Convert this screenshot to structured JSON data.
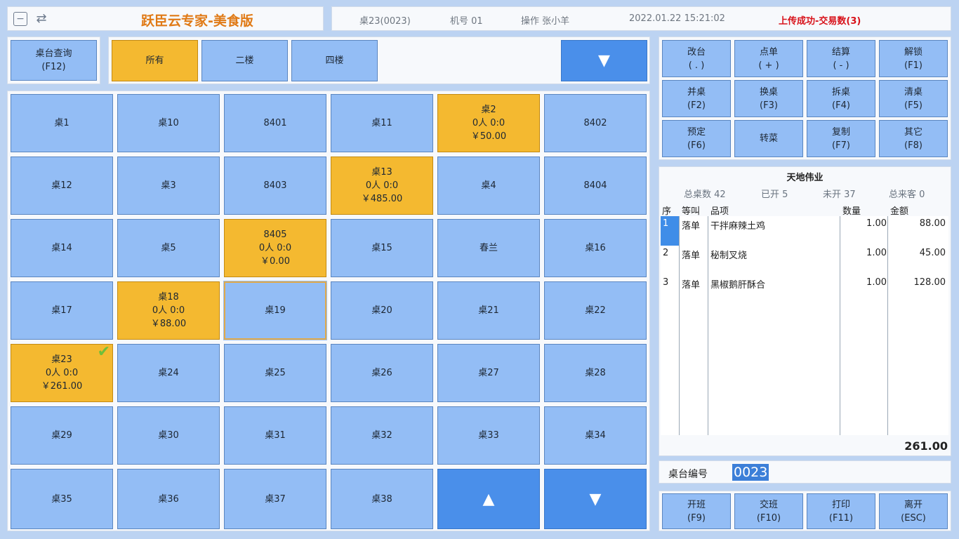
{
  "app": {
    "title": "跃臣云专家-美食版"
  },
  "status_bar": {
    "table": "桌23(0023)",
    "machine": "机号 01",
    "operator": "操作 张小羊",
    "datetime": "2022.01.22 15:21:02",
    "upload": "上传成功-交易数(3)"
  },
  "query_button": {
    "line1": "桌台查询",
    "line2": "(F12)"
  },
  "floors": [
    {
      "label": "所有"
    },
    {
      "label": "二楼"
    },
    {
      "label": "四楼"
    }
  ],
  "floor_scroll_icon": "down-arrow-icon",
  "tables": [
    {
      "name": "桌1"
    },
    {
      "name": "桌10"
    },
    {
      "name": "8401"
    },
    {
      "name": "桌11"
    },
    {
      "name": "桌2",
      "guests": "0人 0:0",
      "amount": "￥50.00",
      "occupied": true
    },
    {
      "name": "8402"
    },
    {
      "name": "桌12"
    },
    {
      "name": "桌3"
    },
    {
      "name": "8403"
    },
    {
      "name": "桌13",
      "guests": "0人 0:0",
      "amount": "￥485.00",
      "occupied": true
    },
    {
      "name": "桌4"
    },
    {
      "name": "8404"
    },
    {
      "name": "桌14"
    },
    {
      "name": "桌5"
    },
    {
      "name": "8405",
      "guests": "0人 0:0",
      "amount": "￥0.00",
      "occupied": true
    },
    {
      "name": "桌15"
    },
    {
      "name": "春兰"
    },
    {
      "name": "桌16"
    },
    {
      "name": "桌17"
    },
    {
      "name": "桌18",
      "guests": "0人 0:0",
      "amount": "￥88.00",
      "occupied": true
    },
    {
      "name": "桌19",
      "selected": true
    },
    {
      "name": "桌20"
    },
    {
      "name": "桌21"
    },
    {
      "name": "桌22"
    },
    {
      "name": "桌23",
      "guests": "0人 0:0",
      "amount": "￥261.00",
      "occupied": true,
      "checked": true
    },
    {
      "name": "桌24"
    },
    {
      "name": "桌25"
    },
    {
      "name": "桌26"
    },
    {
      "name": "桌27"
    },
    {
      "name": "桌28"
    },
    {
      "name": "桌29"
    },
    {
      "name": "桌30"
    },
    {
      "name": "桌31"
    },
    {
      "name": "桌32"
    },
    {
      "name": "桌33"
    },
    {
      "name": "桌34"
    },
    {
      "name": "桌35"
    },
    {
      "name": "桌36"
    },
    {
      "name": "桌37"
    },
    {
      "name": "桌38"
    }
  ],
  "page_up_icon": "up-arrow-icon",
  "page_down_icon": "down-arrow-icon",
  "actions": [
    {
      "line1": "改台",
      "line2": "( . )"
    },
    {
      "line1": "点单",
      "line2": "( + )"
    },
    {
      "line1": "结算",
      "line2": "( - )"
    },
    {
      "line1": "解锁",
      "line2": "(F1)"
    },
    {
      "line1": "并桌",
      "line2": "(F2)"
    },
    {
      "line1": "换桌",
      "line2": "(F3)"
    },
    {
      "line1": "拆桌",
      "line2": "(F4)"
    },
    {
      "line1": "清桌",
      "line2": "(F5)"
    },
    {
      "line1": "预定",
      "line2": "(F6)"
    },
    {
      "line1": "转菜",
      "line2": ""
    },
    {
      "line1": "复制",
      "line2": "(F7)"
    },
    {
      "line1": "其它",
      "line2": "(F8)"
    }
  ],
  "order": {
    "shop_name": "天地伟业",
    "stats": [
      "总桌数 42",
      "已开 5",
      "未开 37",
      "总来客 0"
    ],
    "headers": {
      "seq": "序",
      "call": "等叫",
      "item": "品项",
      "qty": "数量",
      "amount": "金额"
    },
    "rows": [
      {
        "seq": "1",
        "call": "落单",
        "item": "干拌麻辣土鸡",
        "qty": "1.00",
        "amount": "88.00"
      },
      {
        "seq": "2",
        "call": "落单",
        "item": "秘制叉烧",
        "qty": "1.00",
        "amount": "45.00"
      },
      {
        "seq": "3",
        "call": "落单",
        "item": "黑椒鹅肝酥合",
        "qty": "1.00",
        "amount": "128.00"
      }
    ],
    "total": "261.00"
  },
  "table_number": {
    "label": "桌台编号",
    "value": "0023"
  },
  "bottom_actions": [
    {
      "line1": "开班",
      "line2": "(F9)"
    },
    {
      "line1": "交班",
      "line2": "(F10)"
    },
    {
      "line1": "打印",
      "line2": "(F11)"
    },
    {
      "line1": "离开",
      "line2": "(ESC)"
    }
  ],
  "colors": {
    "accent": "#e07a16",
    "occupied": "#f4b930",
    "idle": "#93bdf5",
    "upload": "#d8121a"
  }
}
